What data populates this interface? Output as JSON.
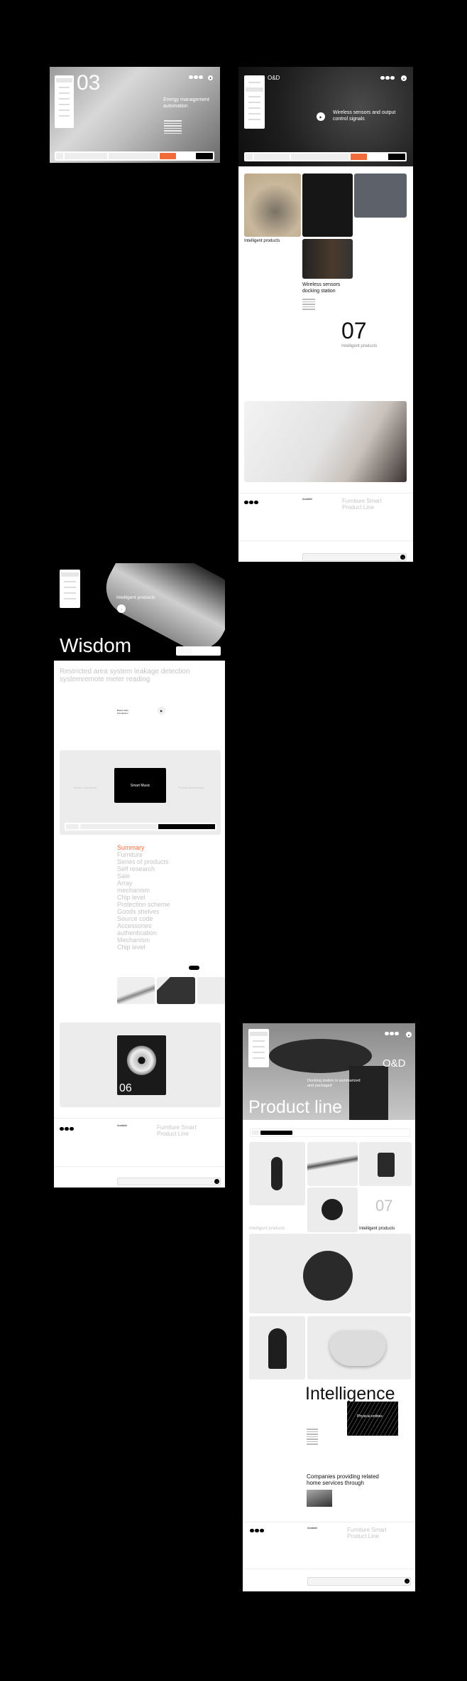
{
  "colors": {
    "accent": "#f26b3a",
    "background": "#000000"
  },
  "panel1": {
    "number": "03",
    "title": "Energy management automation"
  },
  "panel2": {
    "brand": "O&D",
    "hero_title": "Wireless sensors and output control signals",
    "card_title_1": "Intelligent products",
    "card_title_2": "Wireless sensors docking station",
    "big_number": "07",
    "number_caption": "Intelligent products"
  },
  "panel3": {
    "hero_caption": "Intelligent products",
    "hero_word": "Wisdom",
    "headline": "Restricted area system leakage detection systemremote meter reading",
    "video_label": "Brand video introduction",
    "left_label": "Series of products",
    "center_card": "Smart Music",
    "right_label": "Product accessories",
    "summary_items": [
      "Summary",
      "Furniture",
      "Series of products",
      "Self research",
      "Sale",
      "Array",
      "mechanism",
      "Chip level",
      "Protection scheme",
      "Goods shelves",
      "Source code",
      "Accessories",
      "authentication",
      "Mechanism",
      "Chip level"
    ],
    "showcase_number": "06"
  },
  "panel4": {
    "brand": "O&D",
    "hero_caption": "Docking station is summarized and packaged",
    "hero_word": "Product line",
    "big_number": "07",
    "grey_label": "Intelligent products",
    "black_label": "Intelligent products",
    "intelligence": "Intelligence",
    "entities": "Physical entities",
    "companies": "Companies providing related home services through"
  },
  "footer": {
    "available": "Available",
    "title": "Furniture Smart Product Line"
  }
}
